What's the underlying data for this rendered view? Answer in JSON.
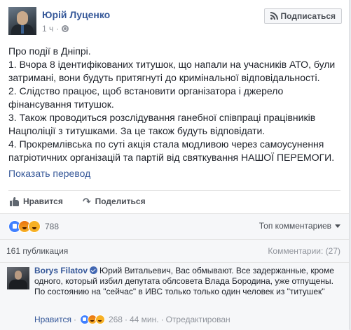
{
  "post": {
    "author": "Юрій Луценко",
    "time": "1 ч",
    "subscribe_label": "Подписаться",
    "paragraphs": [
      "Про події в Дніпрі.",
      "1. Вчора 8 ідентифікованих титушок, що напали на учасників АТО, були затримані, вони будуть притягнуті до кримінальної відповідальності.",
      "2. Слідство працює, щоб встановити організатора і джерело фінансування титушок.",
      "3. Також проводиться розслідування ганебної співпраці працівників Нацполіції з титушками. За це також будуть відповідати.",
      "4. Прокремлівська по суті акція стала модливою через самоусунення патріотичних організацій та партій від святкування НАШОЇ ПЕРЕМОГИ."
    ],
    "translate_label": "Показать перевод"
  },
  "actions": {
    "like_label": "Нравится",
    "share_label": "Поделиться"
  },
  "reactions": {
    "icons": [
      "like-reaction",
      "angry-reaction",
      "haha-reaction"
    ],
    "count": "788",
    "top_comments_label": "Топ комментариев"
  },
  "stats": {
    "publications": "161 публикация",
    "comments": "Комментарии: (27)"
  },
  "comment": {
    "author": "Borys Filatov",
    "text": "Юрий Витальевич, Вас обмывают. Все задержанные, кроме одного, который избил депутата облсовета Влада Бородина, уже отпущены. По состоянию на \"сейчас\" в ИВС только только один человек из \"титушек\"",
    "like_label": "Нравится",
    "reaction_count": "268",
    "time": "44 мин.",
    "edited_label": "Отредактирован",
    "separator": "·"
  },
  "colors": {
    "link": "#365899",
    "meta": "#90949c",
    "like_blue": "#4080ff",
    "angry_orange": "#e9710f",
    "yellow": "#f7b125"
  }
}
